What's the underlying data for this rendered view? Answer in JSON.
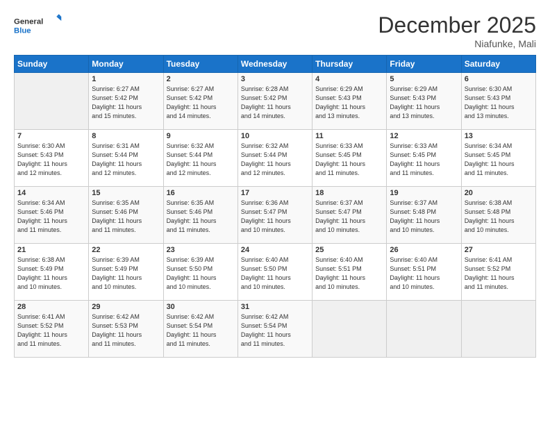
{
  "header": {
    "logo_general": "General",
    "logo_blue": "Blue",
    "month": "December 2025",
    "location": "Niafunke, Mali"
  },
  "days_of_week": [
    "Sunday",
    "Monday",
    "Tuesday",
    "Wednesday",
    "Thursday",
    "Friday",
    "Saturday"
  ],
  "weeks": [
    [
      {
        "day": "",
        "info": ""
      },
      {
        "day": "1",
        "info": "Sunrise: 6:27 AM\nSunset: 5:42 PM\nDaylight: 11 hours\nand 15 minutes."
      },
      {
        "day": "2",
        "info": "Sunrise: 6:27 AM\nSunset: 5:42 PM\nDaylight: 11 hours\nand 14 minutes."
      },
      {
        "day": "3",
        "info": "Sunrise: 6:28 AM\nSunset: 5:42 PM\nDaylight: 11 hours\nand 14 minutes."
      },
      {
        "day": "4",
        "info": "Sunrise: 6:29 AM\nSunset: 5:43 PM\nDaylight: 11 hours\nand 13 minutes."
      },
      {
        "day": "5",
        "info": "Sunrise: 6:29 AM\nSunset: 5:43 PM\nDaylight: 11 hours\nand 13 minutes."
      },
      {
        "day": "6",
        "info": "Sunrise: 6:30 AM\nSunset: 5:43 PM\nDaylight: 11 hours\nand 13 minutes."
      }
    ],
    [
      {
        "day": "7",
        "info": "Sunrise: 6:30 AM\nSunset: 5:43 PM\nDaylight: 11 hours\nand 12 minutes."
      },
      {
        "day": "8",
        "info": "Sunrise: 6:31 AM\nSunset: 5:44 PM\nDaylight: 11 hours\nand 12 minutes."
      },
      {
        "day": "9",
        "info": "Sunrise: 6:32 AM\nSunset: 5:44 PM\nDaylight: 11 hours\nand 12 minutes."
      },
      {
        "day": "10",
        "info": "Sunrise: 6:32 AM\nSunset: 5:44 PM\nDaylight: 11 hours\nand 12 minutes."
      },
      {
        "day": "11",
        "info": "Sunrise: 6:33 AM\nSunset: 5:45 PM\nDaylight: 11 hours\nand 11 minutes."
      },
      {
        "day": "12",
        "info": "Sunrise: 6:33 AM\nSunset: 5:45 PM\nDaylight: 11 hours\nand 11 minutes."
      },
      {
        "day": "13",
        "info": "Sunrise: 6:34 AM\nSunset: 5:45 PM\nDaylight: 11 hours\nand 11 minutes."
      }
    ],
    [
      {
        "day": "14",
        "info": "Sunrise: 6:34 AM\nSunset: 5:46 PM\nDaylight: 11 hours\nand 11 minutes."
      },
      {
        "day": "15",
        "info": "Sunrise: 6:35 AM\nSunset: 5:46 PM\nDaylight: 11 hours\nand 11 minutes."
      },
      {
        "day": "16",
        "info": "Sunrise: 6:35 AM\nSunset: 5:46 PM\nDaylight: 11 hours\nand 11 minutes."
      },
      {
        "day": "17",
        "info": "Sunrise: 6:36 AM\nSunset: 5:47 PM\nDaylight: 11 hours\nand 10 minutes."
      },
      {
        "day": "18",
        "info": "Sunrise: 6:37 AM\nSunset: 5:47 PM\nDaylight: 11 hours\nand 10 minutes."
      },
      {
        "day": "19",
        "info": "Sunrise: 6:37 AM\nSunset: 5:48 PM\nDaylight: 11 hours\nand 10 minutes."
      },
      {
        "day": "20",
        "info": "Sunrise: 6:38 AM\nSunset: 5:48 PM\nDaylight: 11 hours\nand 10 minutes."
      }
    ],
    [
      {
        "day": "21",
        "info": "Sunrise: 6:38 AM\nSunset: 5:49 PM\nDaylight: 11 hours\nand 10 minutes."
      },
      {
        "day": "22",
        "info": "Sunrise: 6:39 AM\nSunset: 5:49 PM\nDaylight: 11 hours\nand 10 minutes."
      },
      {
        "day": "23",
        "info": "Sunrise: 6:39 AM\nSunset: 5:50 PM\nDaylight: 11 hours\nand 10 minutes."
      },
      {
        "day": "24",
        "info": "Sunrise: 6:40 AM\nSunset: 5:50 PM\nDaylight: 11 hours\nand 10 minutes."
      },
      {
        "day": "25",
        "info": "Sunrise: 6:40 AM\nSunset: 5:51 PM\nDaylight: 11 hours\nand 10 minutes."
      },
      {
        "day": "26",
        "info": "Sunrise: 6:40 AM\nSunset: 5:51 PM\nDaylight: 11 hours\nand 10 minutes."
      },
      {
        "day": "27",
        "info": "Sunrise: 6:41 AM\nSunset: 5:52 PM\nDaylight: 11 hours\nand 11 minutes."
      }
    ],
    [
      {
        "day": "28",
        "info": "Sunrise: 6:41 AM\nSunset: 5:52 PM\nDaylight: 11 hours\nand 11 minutes."
      },
      {
        "day": "29",
        "info": "Sunrise: 6:42 AM\nSunset: 5:53 PM\nDaylight: 11 hours\nand 11 minutes."
      },
      {
        "day": "30",
        "info": "Sunrise: 6:42 AM\nSunset: 5:54 PM\nDaylight: 11 hours\nand 11 minutes."
      },
      {
        "day": "31",
        "info": "Sunrise: 6:42 AM\nSunset: 5:54 PM\nDaylight: 11 hours\nand 11 minutes."
      },
      {
        "day": "",
        "info": ""
      },
      {
        "day": "",
        "info": ""
      },
      {
        "day": "",
        "info": ""
      }
    ]
  ]
}
